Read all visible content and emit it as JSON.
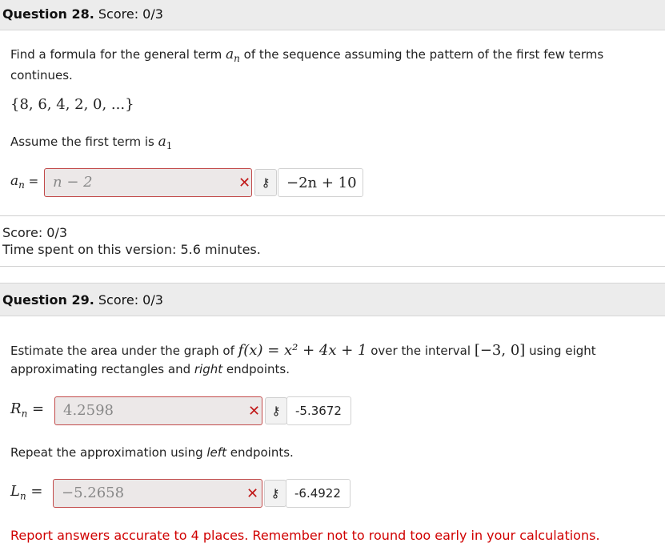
{
  "q28": {
    "header_num": "Question 28.",
    "header_score": " Score: 0/3",
    "prompt_a": "Find a formula for the general term ",
    "prompt_var": "a",
    "prompt_sub": "n",
    "prompt_b": " of the sequence assuming the pattern of the first few terms continues.",
    "sequence": "{8, 6, 4, 2, 0, ...}",
    "assume_text": "Assume the first term is ",
    "assume_var": "a",
    "assume_sub": "1",
    "answer_label_var": "a",
    "answer_label_sub": "n",
    "answer_label_eq": " =",
    "student_answer": "n − 2",
    "correct_answer": "−2n + 10",
    "score_text": "Score: 0/3",
    "time_text": "Time spent on this version: 5.6 minutes."
  },
  "q29": {
    "header_num": "Question 29.",
    "header_score": " Score: 0/3",
    "prompt_a": "Estimate the area under the graph of ",
    "function": "f(x) = x² + 4x + 1",
    "prompt_b": " over the interval ",
    "interval": "[−3, 0]",
    "prompt_c": " using eight approximating rectangles and ",
    "prompt_italic": "right",
    "prompt_d": " endpoints.",
    "r_label_var": "R",
    "r_label_sub": "n",
    "r_student": "4.2598",
    "r_correct": "-5.3672",
    "repeat_a": "Repeat the approximation using ",
    "repeat_italic": "left",
    "repeat_b": " endpoints.",
    "l_label_var": "L",
    "l_label_sub": "n",
    "l_student": "−5.2658",
    "l_correct": "-6.4922",
    "note": "Report answers accurate to 4 places. Remember not to round too early in your calculations."
  },
  "icons": {
    "wrong": "✕",
    "key": "key-icon"
  },
  "colors": {
    "error": "#c11818",
    "note": "#d00000",
    "header_bg": "#ececec"
  }
}
